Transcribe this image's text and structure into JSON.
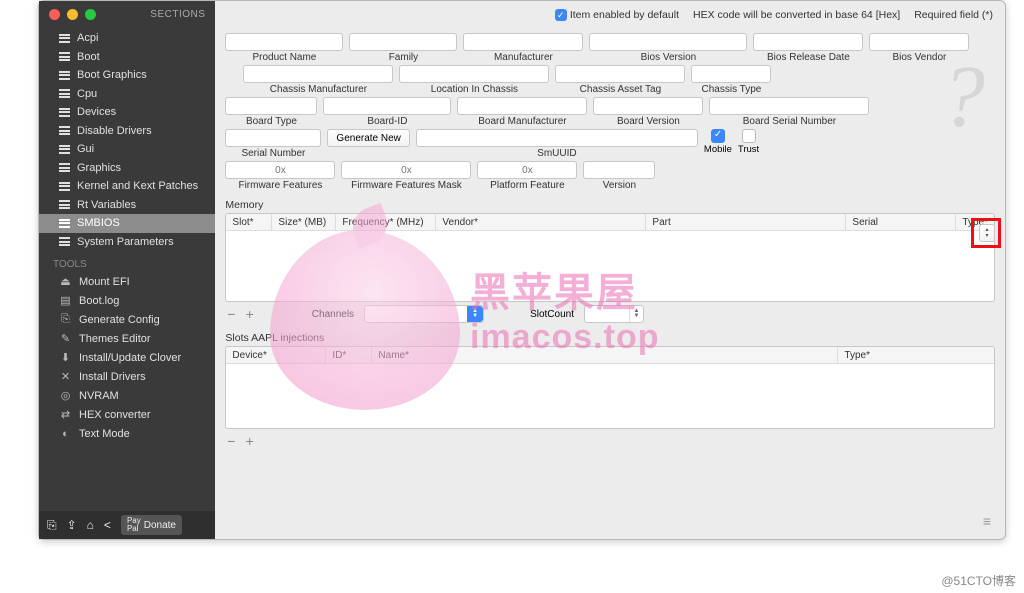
{
  "sidebar": {
    "header": "SECTIONS",
    "sections": [
      "Acpi",
      "Boot",
      "Boot Graphics",
      "Cpu",
      "Devices",
      "Disable Drivers",
      "Gui",
      "Graphics",
      "Kernel and Kext Patches",
      "Rt Variables",
      "SMBIOS",
      "System Parameters"
    ],
    "tools_header": "TOOLS",
    "tools": [
      "Mount EFI",
      "Boot.log",
      "Generate Config",
      "Themes Editor",
      "Install/Update Clover",
      "Install Drivers",
      "NVRAM",
      "HEX converter",
      "Text Mode"
    ],
    "donate": "Donate"
  },
  "topbar": {
    "enabled": "Item enabled by default",
    "hex": "HEX code will be converted in base 64 [Hex]",
    "required": "Required field (*)"
  },
  "fields": {
    "row1": [
      "Product Name",
      "Family",
      "Manufacturer",
      "Bios Version",
      "Bios Release Date",
      "Bios Vendor"
    ],
    "row2": [
      "Chassis Manufacturer",
      "Location In Chassis",
      "Chassis  Asset Tag",
      "Chassis Type"
    ],
    "row3": [
      "Board Type",
      "Board-ID",
      "Board Manufacturer",
      "Board Version",
      "Board Serial Number"
    ],
    "serial": "Serial Number",
    "generate": "Generate New",
    "smuuid": "SmUUID",
    "mobile": "Mobile",
    "trust": "Trust",
    "row5": [
      "Firmware Features",
      "Firmware Features Mask",
      "Platform Feature",
      "Version"
    ],
    "hex_ph": "0x"
  },
  "memory": {
    "title": "Memory",
    "cols": [
      "Slot*",
      "Size* (MB)",
      "Frequency* (MHz)",
      "Vendor*",
      "Part",
      "Serial",
      "Type*"
    ],
    "channels": "Channels",
    "slotcount": "SlotCount"
  },
  "slots": {
    "title": "Slots AAPL injections",
    "cols": [
      "Device*",
      "ID*",
      "Name*",
      "Type*"
    ]
  },
  "watermark": {
    "l1": "黑苹果屋",
    "l2": "imacos.top"
  },
  "credit": "@51CTO博客",
  "chart_data": null
}
